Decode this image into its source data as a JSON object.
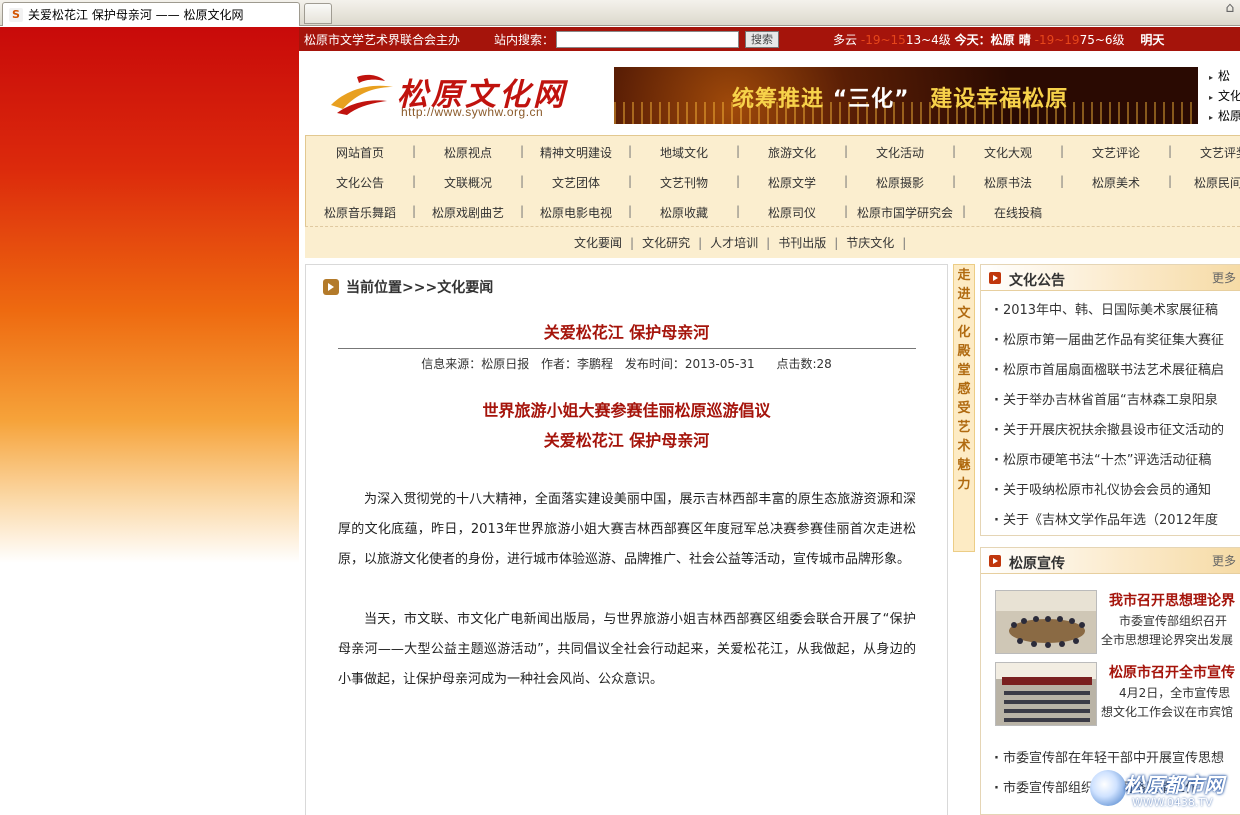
{
  "browser": {
    "tab_title": "关爱松花江 保护母亲河 —— 松原文化网",
    "favicon": "site-favicon"
  },
  "topbar": {
    "host": "松原市文学艺术界联合会主办",
    "search_label": "站内搜索：",
    "search_value": "",
    "search_button": "搜索",
    "weather_today_word": "多云",
    "weather_temp1": "-19",
    "weather_temp1b": "~15",
    "weather_temp1c": "13~4级",
    "weather_today_label": "今天：松原 晴",
    "weather_temp2": "-19",
    "weather_temp2b": "~19",
    "weather_temp2c": "75~6级",
    "weather_tomorrow": "明天"
  },
  "header": {
    "logo_name": "松原文化网",
    "logo_url": "http://www.sywhw.org.cn",
    "banner_slogan_a": "统筹推进",
    "banner_slogan_b": "“三化”",
    "banner_slogan_c": "建设幸福松原",
    "right_links": [
      "松",
      "文化",
      "松原"
    ]
  },
  "nav": {
    "row1": [
      "网站首页",
      "松原视点",
      "精神文明建设",
      "地域文化",
      "旅游文化",
      "文化活动",
      "文化大观",
      "文艺评论",
      "文艺评奖"
    ],
    "row2": [
      "文化公告",
      "文联概况",
      "文艺团体",
      "文艺刊物",
      "松原文学",
      "松原摄影",
      "松原书法",
      "松原美术",
      "松原民间文"
    ],
    "row3": [
      "松原音乐舞蹈",
      "松原戏剧曲艺",
      "松原电影电视",
      "松原收藏",
      "松原司仪",
      "松原市国学研究会",
      "在线投稿"
    ],
    "subnav": [
      "文化要闻",
      "文化研究",
      "人才培训",
      "书刊出版",
      "节庆文化"
    ]
  },
  "article": {
    "crumb": "当前位置>>>文化要闻",
    "title": "关爱松花江  保护母亲河",
    "source": "信息来源：松原日报",
    "author": "作者：李鹏程",
    "date": "发布时间：2013-05-31",
    "clicks": "点击数:28",
    "subtitle1": "世界旅游小姐大赛参赛佳丽松原巡游倡议",
    "subtitle2": "关爱松花江  保护母亲河",
    "para1": "为深入贯彻党的十八大精神，全面落实建设美丽中国，展示吉林西部丰富的原生态旅游资源和深厚的文化底蕴，昨日，2013年世界旅游小姐大赛吉林西部赛区年度冠军总决赛参赛佳丽首次走进松原，以旅游文化使者的身份，进行城市体验巡游、品牌推广、社会公益等活动，宣传城市品牌形象。",
    "para2": "当天，市文联、市文化广电新闻出版局，与世界旅游小姐吉林西部赛区组委会联合开展了“保护母亲河——大型公益主题巡游活动”，共同倡议全社会行动起来，关爱松花江，从我做起，从身边的小事做起，让保护母亲河成为一种社会风尚、公众意识。"
  },
  "vslogan": [
    "走",
    "进",
    "文",
    "化",
    "殿",
    "堂",
    "感",
    "受",
    "艺",
    "术",
    "魅",
    "力"
  ],
  "notice_panel": {
    "title": "文化公告",
    "more": "更多",
    "items": [
      "2013年中、韩、日国际美术家展征稿",
      "松原市第一届曲艺作品有奖征集大赛征",
      "松原市首届扇面楹联书法艺术展征稿启",
      "关于举办吉林省首届“吉林森工泉阳泉",
      "关于开展庆祝扶余撤县设市征文活动的",
      "松原市硬笔书法“十杰”评选活动征稿",
      "关于吸纳松原市礼仪协会会员的通知",
      "关于《吉林文学作品年选（2012年度"
    ]
  },
  "promo_panel": {
    "title": "松原宣传",
    "more": "更多",
    "promos": [
      {
        "title": "我市召开思想理论界",
        "desc1": "市委宣传部组织召开",
        "desc2": "全市思想理论界突出发展"
      },
      {
        "title": "松原市召开全市宣传",
        "desc1": "4月2日，全市宣传思",
        "desc2": "想文化工作会议在市宾馆"
      }
    ],
    "items": [
      "市委宣传部在年轻干部中开展宣传思想",
      "市委宣传部组织召开网络舆情工作"
    ]
  },
  "watermark": {
    "name": "松原都市网",
    "url": "WWW.0438.TV"
  },
  "colors": {
    "brand_red": "#a5140b",
    "nav_bg": "#fbeecf"
  }
}
